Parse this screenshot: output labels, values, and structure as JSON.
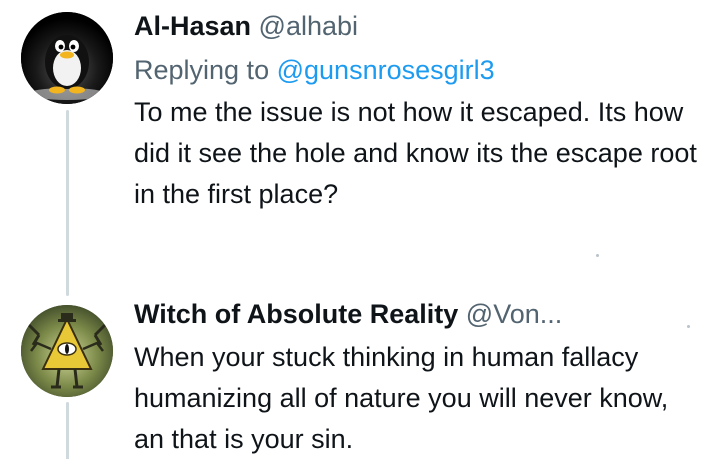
{
  "tweets": [
    {
      "display_name": "Al-Hasan",
      "handle": "@alhabi",
      "replying_prefix": "Replying to",
      "replying_handle": "@gunsnrosesgirl3",
      "text": "To me the issue is not how it escaped. Its how did it see the hole and know its the escape root in the first place?",
      "avatar_icon": "penguin-avatar"
    },
    {
      "display_name": "Witch of Absolute Reality",
      "handle": "@Von...",
      "text": "When your stuck thinking in human fallacy humanizing all of nature you will never know, an that is your sin.",
      "avatar_icon": "triangle-cyclops-avatar"
    }
  ],
  "colors": {
    "text": "#0f1419",
    "secondary": "#536471",
    "link": "#1d9bf0",
    "thread_line": "#cfd9de"
  }
}
